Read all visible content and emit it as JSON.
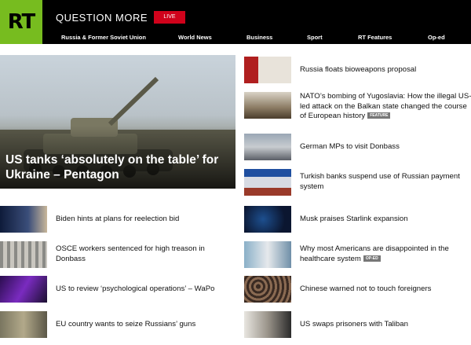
{
  "header": {
    "logo": "RT",
    "tagline": "QUESTION MORE",
    "live_label": "LIVE",
    "nav": [
      {
        "label": "Russia & Former Soviet Union"
      },
      {
        "label": "World News"
      },
      {
        "label": "Business"
      },
      {
        "label": "Sport"
      },
      {
        "label": "RT Features"
      },
      {
        "label": "Op-ed"
      }
    ]
  },
  "hero": {
    "title": "US tanks ‘absolutely on the table’ for Ukraine – Pentagon"
  },
  "left_stories": [
    {
      "title": "Biden hints at plans for reelection bid"
    },
    {
      "title": "OSCE workers sentenced for high treason in Donbass"
    },
    {
      "title": "US to review ‘psychological operations’ – WaPo"
    },
    {
      "title": "EU country wants to seize Russians’ guns"
    }
  ],
  "right_stories": [
    {
      "title": "Russia floats bioweapons proposal",
      "badge": ""
    },
    {
      "title": "NATO’s bombing of Yugoslavia: How the illegal US-led attack on the Balkan state changed the course of European history",
      "badge": "FEATURE"
    },
    {
      "title": "German MPs to visit Donbass",
      "badge": ""
    },
    {
      "title": "Turkish banks suspend use of Russian payment system",
      "badge": ""
    },
    {
      "title": "Musk praises Starlink expansion",
      "badge": ""
    },
    {
      "title": "Why most Americans are disappointed in the healthcare system",
      "badge": "OP-ED"
    },
    {
      "title": "Chinese warned not to touch foreigners",
      "badge": ""
    },
    {
      "title": "US swaps prisoners with Taliban",
      "badge": ""
    }
  ],
  "colors": {
    "brand_green": "#77bc1f",
    "live_red": "#d0021b",
    "header_bg": "#000000"
  }
}
